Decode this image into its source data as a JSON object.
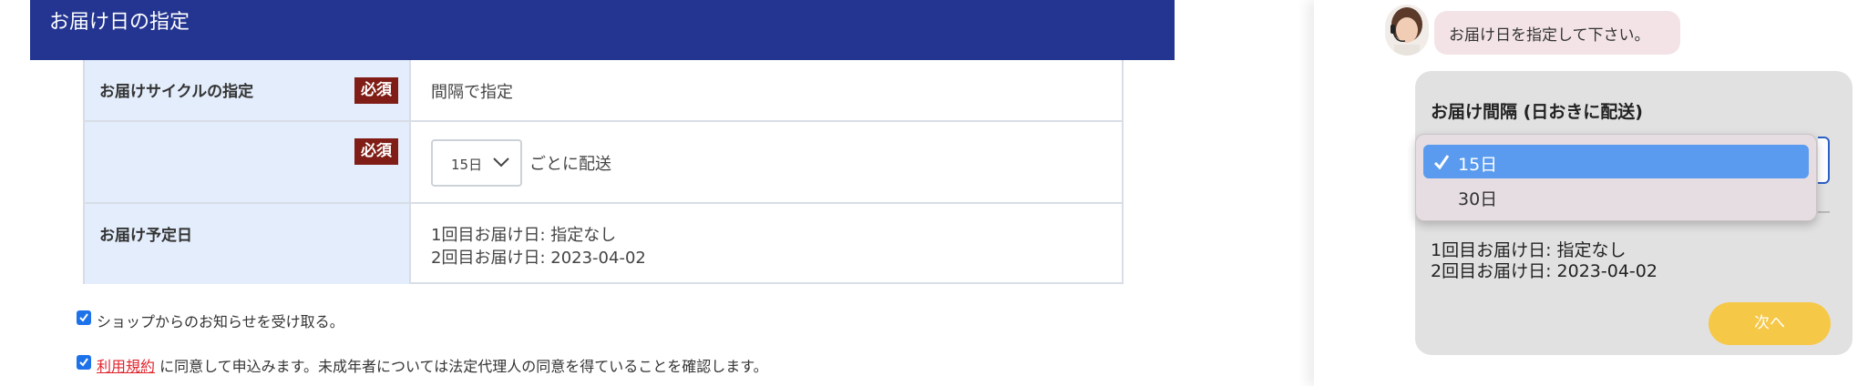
{
  "form": {
    "section_title": "お届け日の指定",
    "cycle_label": "お届けサイクルの指定",
    "required_badge": "必須",
    "cycle_value": "間隔で指定",
    "interval_select_value": "15日",
    "interval_suffix": "ごとに配送",
    "schedule_label": "お届け予定日",
    "schedule_line1": "1回目お届け日: 指定なし",
    "schedule_line2": "2回目お届け日: 2023-04-02",
    "newsletter_text": "ショップからのお知らせを受け取る。",
    "terms_link": "利用規約",
    "terms_text": " に同意して申込みます。未成年者については法定代理人の同意を得ていることを確認します。"
  },
  "chat": {
    "bot_message": "お届け日を指定して下さい。",
    "card_label": "お届け間隔 (日おきに配送)",
    "dropdown_options": [
      "15日",
      "30日"
    ],
    "selected_option": "15日",
    "schedule_line1": "1回目お届け日: 指定なし",
    "schedule_line2": "2回目お届け日: 2023-04-02",
    "next_button": "次へ"
  },
  "colors": {
    "header": "#233590",
    "required_badge": "#7f1d16",
    "label_cell": "#e3edfb",
    "link": "#e0242c",
    "selected_option": "#5a9bef",
    "next_button": "#f6c847"
  },
  "icons": [
    "chevron-down-icon",
    "checkbox-checked-icon",
    "checkmark-icon",
    "avatar-image"
  ]
}
